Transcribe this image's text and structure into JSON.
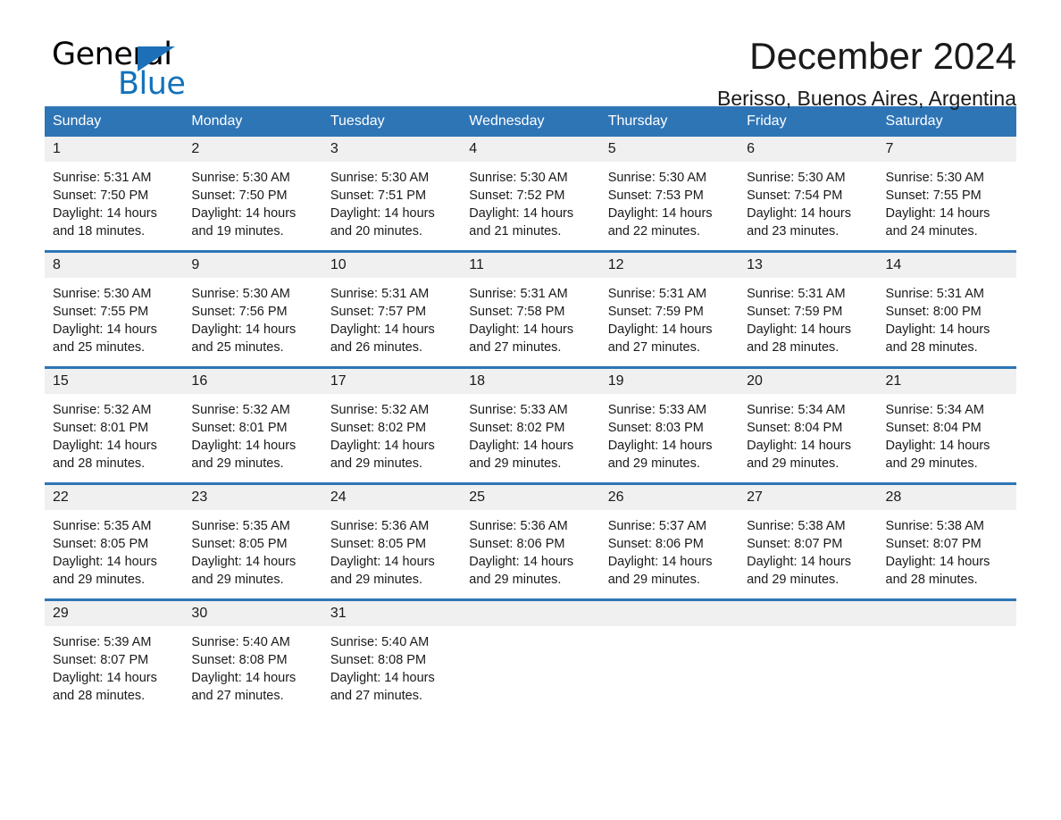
{
  "brand": {
    "name_part1": "General",
    "name_part2": "Blue",
    "triangle_color": "#1d70b7",
    "blue_text_color": "#1272bb"
  },
  "header": {
    "title": "December 2024",
    "location": "Berisso, Buenos Aires, Argentina"
  },
  "theme": {
    "header_blue": "#2e75b6",
    "daynum_gray": "#f0f0f0",
    "text_color": "#1a1a1a"
  },
  "weekday_headers": [
    "Sunday",
    "Monday",
    "Tuesday",
    "Wednesday",
    "Thursday",
    "Friday",
    "Saturday"
  ],
  "weeks": [
    [
      {
        "day": "1",
        "sunrise": "Sunrise: 5:31 AM",
        "sunset": "Sunset: 7:50 PM",
        "daylight_line1": "Daylight: 14 hours",
        "daylight_line2": "and 18 minutes."
      },
      {
        "day": "2",
        "sunrise": "Sunrise: 5:30 AM",
        "sunset": "Sunset: 7:50 PM",
        "daylight_line1": "Daylight: 14 hours",
        "daylight_line2": "and 19 minutes."
      },
      {
        "day": "3",
        "sunrise": "Sunrise: 5:30 AM",
        "sunset": "Sunset: 7:51 PM",
        "daylight_line1": "Daylight: 14 hours",
        "daylight_line2": "and 20 minutes."
      },
      {
        "day": "4",
        "sunrise": "Sunrise: 5:30 AM",
        "sunset": "Sunset: 7:52 PM",
        "daylight_line1": "Daylight: 14 hours",
        "daylight_line2": "and 21 minutes."
      },
      {
        "day": "5",
        "sunrise": "Sunrise: 5:30 AM",
        "sunset": "Sunset: 7:53 PM",
        "daylight_line1": "Daylight: 14 hours",
        "daylight_line2": "and 22 minutes."
      },
      {
        "day": "6",
        "sunrise": "Sunrise: 5:30 AM",
        "sunset": "Sunset: 7:54 PM",
        "daylight_line1": "Daylight: 14 hours",
        "daylight_line2": "and 23 minutes."
      },
      {
        "day": "7",
        "sunrise": "Sunrise: 5:30 AM",
        "sunset": "Sunset: 7:55 PM",
        "daylight_line1": "Daylight: 14 hours",
        "daylight_line2": "and 24 minutes."
      }
    ],
    [
      {
        "day": "8",
        "sunrise": "Sunrise: 5:30 AM",
        "sunset": "Sunset: 7:55 PM",
        "daylight_line1": "Daylight: 14 hours",
        "daylight_line2": "and 25 minutes."
      },
      {
        "day": "9",
        "sunrise": "Sunrise: 5:30 AM",
        "sunset": "Sunset: 7:56 PM",
        "daylight_line1": "Daylight: 14 hours",
        "daylight_line2": "and 25 minutes."
      },
      {
        "day": "10",
        "sunrise": "Sunrise: 5:31 AM",
        "sunset": "Sunset: 7:57 PM",
        "daylight_line1": "Daylight: 14 hours",
        "daylight_line2": "and 26 minutes."
      },
      {
        "day": "11",
        "sunrise": "Sunrise: 5:31 AM",
        "sunset": "Sunset: 7:58 PM",
        "daylight_line1": "Daylight: 14 hours",
        "daylight_line2": "and 27 minutes."
      },
      {
        "day": "12",
        "sunrise": "Sunrise: 5:31 AM",
        "sunset": "Sunset: 7:59 PM",
        "daylight_line1": "Daylight: 14 hours",
        "daylight_line2": "and 27 minutes."
      },
      {
        "day": "13",
        "sunrise": "Sunrise: 5:31 AM",
        "sunset": "Sunset: 7:59 PM",
        "daylight_line1": "Daylight: 14 hours",
        "daylight_line2": "and 28 minutes."
      },
      {
        "day": "14",
        "sunrise": "Sunrise: 5:31 AM",
        "sunset": "Sunset: 8:00 PM",
        "daylight_line1": "Daylight: 14 hours",
        "daylight_line2": "and 28 minutes."
      }
    ],
    [
      {
        "day": "15",
        "sunrise": "Sunrise: 5:32 AM",
        "sunset": "Sunset: 8:01 PM",
        "daylight_line1": "Daylight: 14 hours",
        "daylight_line2": "and 28 minutes."
      },
      {
        "day": "16",
        "sunrise": "Sunrise: 5:32 AM",
        "sunset": "Sunset: 8:01 PM",
        "daylight_line1": "Daylight: 14 hours",
        "daylight_line2": "and 29 minutes."
      },
      {
        "day": "17",
        "sunrise": "Sunrise: 5:32 AM",
        "sunset": "Sunset: 8:02 PM",
        "daylight_line1": "Daylight: 14 hours",
        "daylight_line2": "and 29 minutes."
      },
      {
        "day": "18",
        "sunrise": "Sunrise: 5:33 AM",
        "sunset": "Sunset: 8:02 PM",
        "daylight_line1": "Daylight: 14 hours",
        "daylight_line2": "and 29 minutes."
      },
      {
        "day": "19",
        "sunrise": "Sunrise: 5:33 AM",
        "sunset": "Sunset: 8:03 PM",
        "daylight_line1": "Daylight: 14 hours",
        "daylight_line2": "and 29 minutes."
      },
      {
        "day": "20",
        "sunrise": "Sunrise: 5:34 AM",
        "sunset": "Sunset: 8:04 PM",
        "daylight_line1": "Daylight: 14 hours",
        "daylight_line2": "and 29 minutes."
      },
      {
        "day": "21",
        "sunrise": "Sunrise: 5:34 AM",
        "sunset": "Sunset: 8:04 PM",
        "daylight_line1": "Daylight: 14 hours",
        "daylight_line2": "and 29 minutes."
      }
    ],
    [
      {
        "day": "22",
        "sunrise": "Sunrise: 5:35 AM",
        "sunset": "Sunset: 8:05 PM",
        "daylight_line1": "Daylight: 14 hours",
        "daylight_line2": "and 29 minutes."
      },
      {
        "day": "23",
        "sunrise": "Sunrise: 5:35 AM",
        "sunset": "Sunset: 8:05 PM",
        "daylight_line1": "Daylight: 14 hours",
        "daylight_line2": "and 29 minutes."
      },
      {
        "day": "24",
        "sunrise": "Sunrise: 5:36 AM",
        "sunset": "Sunset: 8:05 PM",
        "daylight_line1": "Daylight: 14 hours",
        "daylight_line2": "and 29 minutes."
      },
      {
        "day": "25",
        "sunrise": "Sunrise: 5:36 AM",
        "sunset": "Sunset: 8:06 PM",
        "daylight_line1": "Daylight: 14 hours",
        "daylight_line2": "and 29 minutes."
      },
      {
        "day": "26",
        "sunrise": "Sunrise: 5:37 AM",
        "sunset": "Sunset: 8:06 PM",
        "daylight_line1": "Daylight: 14 hours",
        "daylight_line2": "and 29 minutes."
      },
      {
        "day": "27",
        "sunrise": "Sunrise: 5:38 AM",
        "sunset": "Sunset: 8:07 PM",
        "daylight_line1": "Daylight: 14 hours",
        "daylight_line2": "and 29 minutes."
      },
      {
        "day": "28",
        "sunrise": "Sunrise: 5:38 AM",
        "sunset": "Sunset: 8:07 PM",
        "daylight_line1": "Daylight: 14 hours",
        "daylight_line2": "and 28 minutes."
      }
    ],
    [
      {
        "day": "29",
        "sunrise": "Sunrise: 5:39 AM",
        "sunset": "Sunset: 8:07 PM",
        "daylight_line1": "Daylight: 14 hours",
        "daylight_line2": "and 28 minutes."
      },
      {
        "day": "30",
        "sunrise": "Sunrise: 5:40 AM",
        "sunset": "Sunset: 8:08 PM",
        "daylight_line1": "Daylight: 14 hours",
        "daylight_line2": "and 27 minutes."
      },
      {
        "day": "31",
        "sunrise": "Sunrise: 5:40 AM",
        "sunset": "Sunset: 8:08 PM",
        "daylight_line1": "Daylight: 14 hours",
        "daylight_line2": "and 27 minutes."
      },
      {
        "day": "",
        "sunrise": "",
        "sunset": "",
        "daylight_line1": "",
        "daylight_line2": ""
      },
      {
        "day": "",
        "sunrise": "",
        "sunset": "",
        "daylight_line1": "",
        "daylight_line2": ""
      },
      {
        "day": "",
        "sunrise": "",
        "sunset": "",
        "daylight_line1": "",
        "daylight_line2": ""
      },
      {
        "day": "",
        "sunrise": "",
        "sunset": "",
        "daylight_line1": "",
        "daylight_line2": ""
      }
    ]
  ]
}
